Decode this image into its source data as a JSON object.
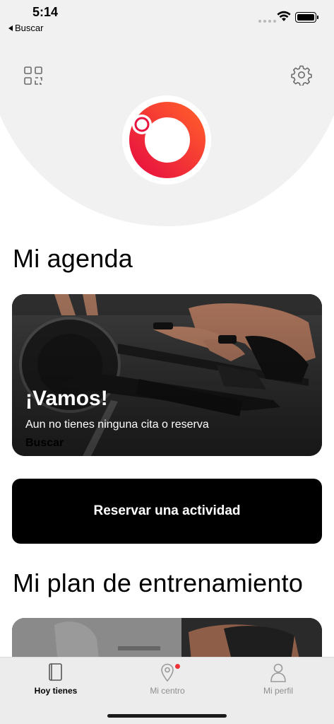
{
  "status_bar": {
    "time": "5:14",
    "back_label": "Buscar"
  },
  "header": {
    "qr_icon": "qr-code-icon",
    "settings_icon": "gear-icon",
    "logo_colors": [
      "#e8133f",
      "#ff5a2c"
    ]
  },
  "agenda": {
    "title": "Mi agenda",
    "card": {
      "heading": "¡Vamos!",
      "subtitle": "Aun no tienes ninguna cita o reserva",
      "link": "Buscar"
    },
    "reserve_button": "Reservar una actividad"
  },
  "plan": {
    "title": "Mi plan de entrenamiento"
  },
  "tabs": [
    {
      "label": "Hoy tienes",
      "icon": "notebook-icon",
      "active": true
    },
    {
      "label": "Mi centro",
      "icon": "location-pin-icon",
      "active": false,
      "notification": true
    },
    {
      "label": "Mi perfil",
      "icon": "person-icon",
      "active": false
    }
  ],
  "colors": {
    "accent": "#ee3237",
    "button_bg": "#000000",
    "header_bg": "#f1f1f1"
  }
}
